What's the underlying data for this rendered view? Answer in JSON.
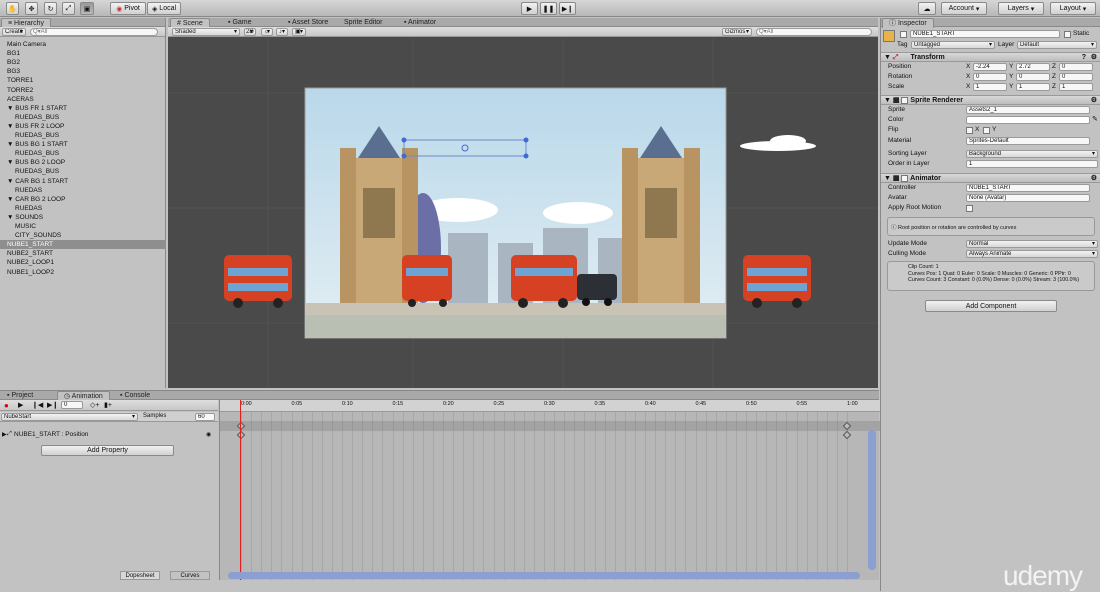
{
  "toolbar": {
    "pivot": "Pivot",
    "local": "Local",
    "account": "Account",
    "layers": "Layers",
    "layout": "Layout"
  },
  "hierarchy": {
    "tab": "Hierarchy",
    "create": "Create",
    "search_placeholder": "Q▾All",
    "items": [
      {
        "label": "Main Camera",
        "indent": 0
      },
      {
        "label": "BG1",
        "indent": 0
      },
      {
        "label": "BG2",
        "indent": 0
      },
      {
        "label": "BG3",
        "indent": 0
      },
      {
        "label": "TORRE1",
        "indent": 0
      },
      {
        "label": "TORRE2",
        "indent": 0
      },
      {
        "label": "ACERAS",
        "indent": 0
      },
      {
        "label": "▼ BUS FR 1 START",
        "indent": 0
      },
      {
        "label": "RUEDAS_BUS",
        "indent": 1
      },
      {
        "label": "▼ BUS FR 2 LOOP",
        "indent": 0
      },
      {
        "label": "RUEDAS_BUS",
        "indent": 1
      },
      {
        "label": "▼ BUS BG 1 START",
        "indent": 0
      },
      {
        "label": "RUEDAS_BUS",
        "indent": 1
      },
      {
        "label": "▼ BUS BG 2 LOOP",
        "indent": 0
      },
      {
        "label": "RUEDAS_BUS",
        "indent": 1
      },
      {
        "label": "▼ CAR BG 1 START",
        "indent": 0
      },
      {
        "label": "RUEDAS",
        "indent": 1
      },
      {
        "label": "▼ CAR BG 2 LOOP",
        "indent": 0
      },
      {
        "label": "RUEDAS",
        "indent": 1
      },
      {
        "label": "▼ SOUNDS",
        "indent": 0
      },
      {
        "label": "MUSIC",
        "indent": 1
      },
      {
        "label": "CITY_SOUNDS",
        "indent": 1
      },
      {
        "label": "NUBE1_START",
        "indent": 0
      },
      {
        "label": "NUBE2_START",
        "indent": 0
      },
      {
        "label": "NUBE2_LOOP1",
        "indent": 0
      },
      {
        "label": "NUBE1_LOOP2",
        "indent": 0
      }
    ],
    "selected_index": 22
  },
  "scene": {
    "tabs": [
      "Scene",
      "Game",
      "Asset Store",
      "Sprite Editor",
      "Animator"
    ],
    "shaded": "Shaded",
    "mode_2d": "2D",
    "gizmos": "Gizmos",
    "search_placeholder": "Q▾All"
  },
  "inspector": {
    "tab": "Inspector",
    "object_name": "NUBE1_START",
    "static_label": "Static",
    "tag_label": "Tag",
    "tag_value": "Untagged",
    "layer_label": "Layer",
    "layer_value": "Default",
    "transform": {
      "title": "Transform",
      "rows": [
        {
          "label": "Position",
          "x": "-2.24",
          "y": "2.72",
          "z": "0"
        },
        {
          "label": "Rotation",
          "x": "0",
          "y": "0",
          "z": "0"
        },
        {
          "label": "Scale",
          "x": "1",
          "y": "1",
          "z": "1"
        }
      ]
    },
    "sprite_renderer": {
      "title": "Sprite Renderer",
      "sprite_label": "Sprite",
      "sprite_value": "Assets2_1",
      "color_label": "Color",
      "flip_label": "Flip",
      "flip_x": "X",
      "flip_y": "Y",
      "material_label": "Material",
      "material_value": "Sprites-Default",
      "sorting_layer_label": "Sorting Layer",
      "sorting_layer_value": "Background",
      "order_label": "Order in Layer",
      "order_value": "1"
    },
    "animator": {
      "title": "Animator",
      "controller_label": "Controller",
      "controller_value": "NUBE1_START",
      "avatar_label": "Avatar",
      "avatar_value": "None (Avatar)",
      "apply_root_label": "Apply Root Motion",
      "info": "Root position or rotation are controlled by curves",
      "update_mode_label": "Update Mode",
      "update_mode_value": "Normal",
      "culling_mode_label": "Culling Mode",
      "culling_mode_value": "Always Animate",
      "stats_1": "Clip Count: 1",
      "stats_2": "Curves Pos: 1 Quat: 0 Euler: 0 Scale: 0 Muscles: 0 Generic: 0 PPtr: 0",
      "stats_3": "Curves Count: 3 Constant: 0 (0.0%) Dense: 0 (0.0%) Stream: 3 (100.0%)"
    },
    "add_component": "Add Component"
  },
  "animation": {
    "tabs": [
      "Project",
      "Animation",
      "Console"
    ],
    "frame": "0",
    "clip": "NubeStart",
    "samples_label": "Samples",
    "samples_value": "60",
    "property": "NUBE1_START : Position",
    "add_property": "Add Property",
    "ticks": [
      "0:00",
      "0:05",
      "0:10",
      "0:15",
      "0:20",
      "0:25",
      "0:30",
      "0:35",
      "0:40",
      "0:45",
      "0:50",
      "0:55",
      "1:00"
    ],
    "dopesheet": "Dopesheet",
    "curves": "Curves"
  },
  "watermark": "udemy"
}
